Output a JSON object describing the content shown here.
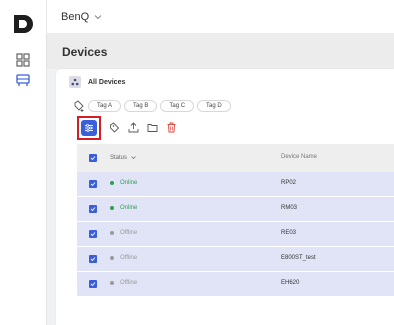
{
  "topbar": {
    "brand": "BenQ"
  },
  "page": {
    "title": "Devices"
  },
  "breadcrumb": {
    "label": "All Devices"
  },
  "tags": [
    "Tag A",
    "Tag B",
    "Tag C",
    "Tag D"
  ],
  "table": {
    "columns": {
      "status": "Status",
      "name": "Device Name"
    },
    "rows": [
      {
        "status": "Online",
        "name": "RP02"
      },
      {
        "status": "Online",
        "name": "RM03"
      },
      {
        "status": "Offline",
        "name": "RE03"
      },
      {
        "status": "Offline",
        "name": "E800ST_test"
      },
      {
        "status": "Offline",
        "name": "EH620"
      }
    ]
  },
  "colors": {
    "accent": "#3b5fd9",
    "highlight": "#d21f26",
    "online": "#2e9e4f",
    "offline": "#9a9a9a",
    "selected_row": "#e1e4f7",
    "delete": "#e0423a"
  },
  "icons": [
    "logo-icon",
    "dashboard-icon",
    "device-icon",
    "chevron-down-icon",
    "group-icon",
    "tag-add-icon",
    "filter-icon",
    "tag-icon",
    "upload-icon",
    "folder-icon",
    "trash-icon",
    "check-icon"
  ]
}
